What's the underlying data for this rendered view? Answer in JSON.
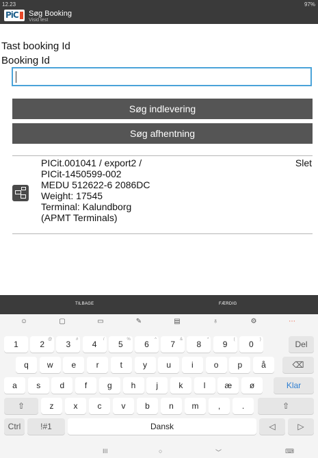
{
  "status_bar": {
    "time": "12.23",
    "indicators": "97%"
  },
  "app": {
    "logo": "PiC",
    "title": "Søg Booking",
    "subtitle": "Visid test"
  },
  "form": {
    "label_1": "Tast booking Id",
    "label_2": "Booking Id",
    "input_value": "",
    "btn_delivery": "Søg indlevering",
    "btn_pickup": "Søg afhentning"
  },
  "result": {
    "delete_label": "Slet",
    "lines": [
      "PICit.001041 / export2 /",
      "PICit-1450599-002",
      "MEDU 512622-6 2086DC",
      "Weight: 17545",
      "Terminal: Kalundborg",
      "(APMT Terminals)"
    ]
  },
  "keyboard": {
    "back_label": "TILBAGE",
    "done_label": "FÆRDIG",
    "toolbar_icons": [
      "emoji-icon",
      "sticker-icon",
      "gif-icon",
      "handwriting-icon",
      "clipboard-icon",
      "microphone-icon",
      "settings-icon",
      "more-icon"
    ],
    "number_row": [
      {
        "k": "1",
        "s": ""
      },
      {
        "k": "2",
        "s": "@"
      },
      {
        "k": "3",
        "s": "#"
      },
      {
        "k": "4",
        "s": "/"
      },
      {
        "k": "5",
        "s": "%"
      },
      {
        "k": "6",
        "s": "^"
      },
      {
        "k": "7",
        "s": "&"
      },
      {
        "k": "8",
        "s": "*"
      },
      {
        "k": "9",
        "s": "("
      },
      {
        "k": "0",
        "s": ")"
      }
    ],
    "delete_key": "Del",
    "row1": [
      "q",
      "w",
      "e",
      "r",
      "t",
      "y",
      "u",
      "i",
      "o",
      "p",
      "å"
    ],
    "row2": [
      "a",
      "s",
      "d",
      "f",
      "g",
      "h",
      "j",
      "k",
      "l",
      "æ",
      "ø"
    ],
    "enter_key": "Klar",
    "row3": [
      "z",
      "x",
      "c",
      "v",
      "b",
      "n",
      "m",
      ",",
      "."
    ],
    "shift_glyph": "⇧",
    "backspace_glyph": "⌫",
    "ctrl": "Ctrl",
    "symbols": "!#1",
    "space": "Dansk",
    "arrow_left": "◁",
    "arrow_right": "▷",
    "nav_recent": "III",
    "nav_home": "○",
    "nav_back": "﹀",
    "nav_kbd": "⌨"
  },
  "colors": {
    "header": "#3a3a3a",
    "button": "#555555",
    "input_border": "#4aa3d9",
    "enter_key": "#2f7fd2"
  }
}
